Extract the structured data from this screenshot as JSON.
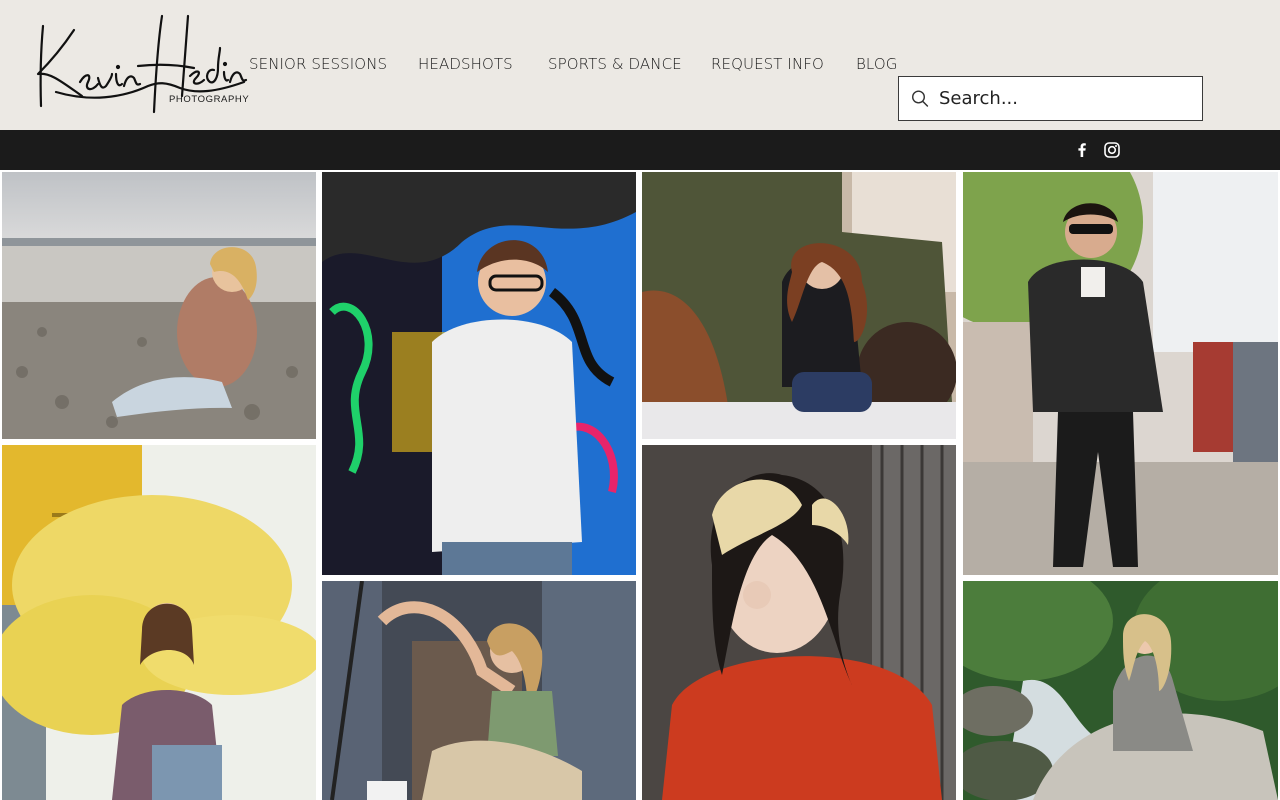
{
  "brand": {
    "script_name": "Kevin Hedin",
    "subtitle": "PHOTOGRAPHY"
  },
  "nav": {
    "items": [
      {
        "label": "SENIOR SESSIONS"
      },
      {
        "label": "HEADSHOTS"
      },
      {
        "label": "SPORTS & DANCE"
      },
      {
        "label": "REQUEST INFO"
      },
      {
        "label": "BLOG"
      }
    ]
  },
  "search": {
    "placeholder": "Search..."
  },
  "social": {
    "icons": [
      "facebook-icon",
      "instagram-icon"
    ]
  },
  "colors": {
    "header_bg": "#ece9e4",
    "bar_bg": "#1b1b1b",
    "text": "#1a1a1a"
  },
  "gallery": {
    "photos": [
      {
        "name": "beach-rocks-portrait"
      },
      {
        "name": "graffiti-wall-portrait"
      },
      {
        "name": "vintage-truck-portrait"
      },
      {
        "name": "suit-street-portrait"
      },
      {
        "name": "yellow-smoke-portrait"
      },
      {
        "name": "metal-door-portrait"
      },
      {
        "name": "red-hoodie-portrait"
      },
      {
        "name": "creek-rock-portrait"
      }
    ]
  }
}
